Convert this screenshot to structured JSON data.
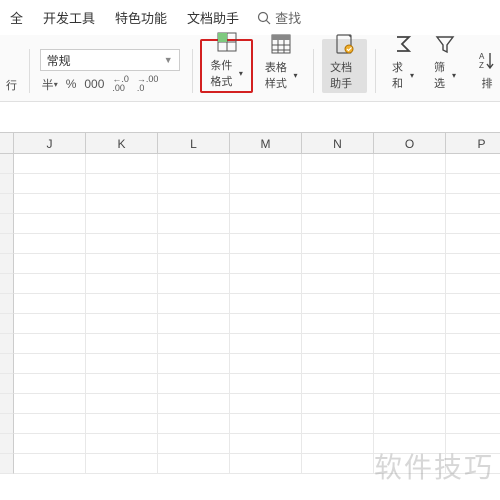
{
  "menu": {
    "safety": "全",
    "dev_tools": "开发工具",
    "features": "特色功能",
    "doc_helper": "文档助手",
    "search_label": "查找"
  },
  "format": {
    "selected": "常规",
    "currency": "半",
    "percent": "%",
    "thousands": "000",
    "inc_dec_1": ".0",
    "inc_dec_2": ".00",
    "dec_inc_1": ".00",
    "dec_inc_2": ".0"
  },
  "frag_left": "行",
  "buttons": {
    "cond_format": "条件格式",
    "table_style": "表格样式",
    "doc_assist": "文档助手",
    "sum": "求和",
    "filter": "筛选",
    "sort": "排"
  },
  "columns": [
    "",
    "J",
    "K",
    "L",
    "M",
    "N",
    "O",
    "P"
  ],
  "row_count": 16,
  "watermark": "软件技巧"
}
